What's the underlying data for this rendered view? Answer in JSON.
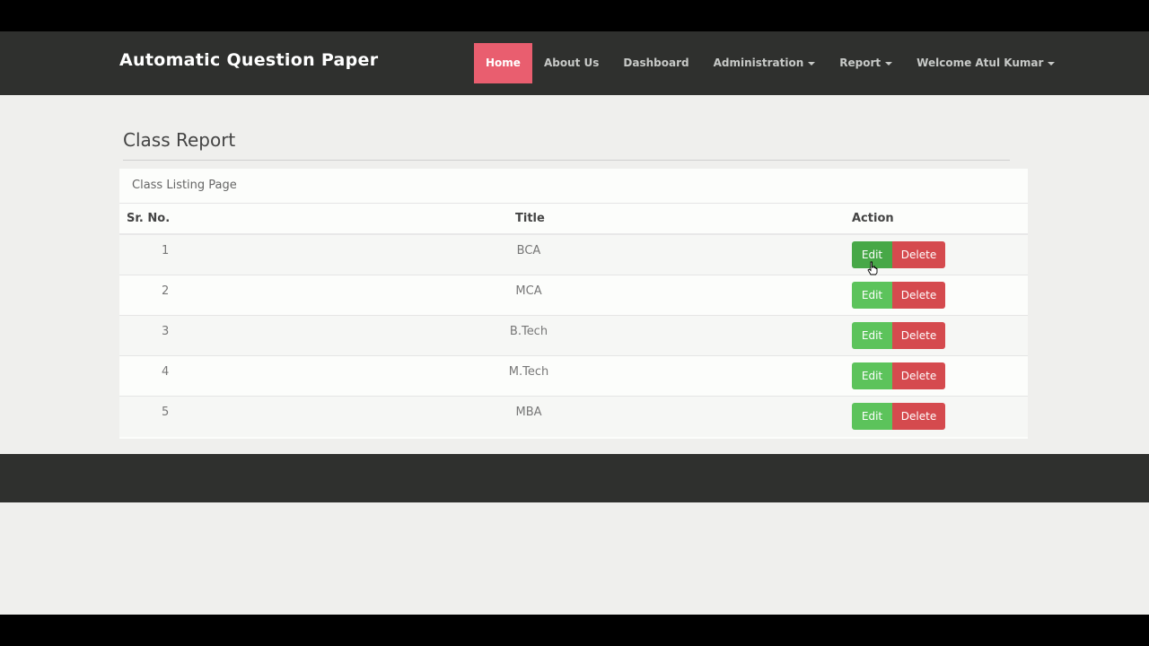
{
  "brand": "Automatic Question Paper",
  "nav": {
    "home": "Home",
    "about": "About Us",
    "dashboard": "Dashboard",
    "administration": "Administration",
    "report": "Report",
    "welcome": "Welcome Atul Kumar"
  },
  "page_title": "Class Report",
  "panel_heading": "Class Listing Page",
  "table": {
    "headers": [
      "Sr. No.",
      "Title",
      "Action"
    ],
    "rows": [
      {
        "sr": "1",
        "title": "BCA"
      },
      {
        "sr": "2",
        "title": "MCA"
      },
      {
        "sr": "3",
        "title": "B.Tech"
      },
      {
        "sr": "4",
        "title": "M.Tech"
      },
      {
        "sr": "5",
        "title": "MBA"
      }
    ],
    "edit_label": "Edit",
    "delete_label": "Delete"
  },
  "colors": {
    "navbar": "#2f302e",
    "active_nav": "#e95e6f",
    "edit_button": "#5cc35b",
    "delete_button": "#d54a4e"
  }
}
